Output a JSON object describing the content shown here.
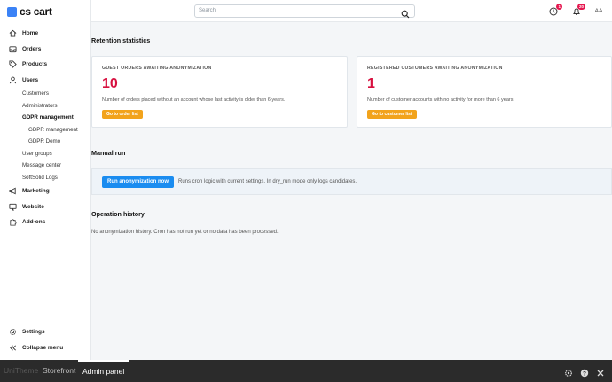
{
  "app": {
    "logo_text": "cs cart",
    "accent": "#3b82f6"
  },
  "sidebar": {
    "items": [
      {
        "label": "Home",
        "icon": "home-icon"
      },
      {
        "label": "Orders",
        "icon": "inbox-icon"
      },
      {
        "label": "Products",
        "icon": "tag-icon"
      },
      {
        "label": "Users",
        "icon": "users-icon"
      }
    ],
    "users_sub": [
      "Customers",
      "Administrators",
      "GDPR management"
    ],
    "gdpr_sub": [
      "GDPR management",
      "GDPR Demo"
    ],
    "users_sub2": [
      "User groups",
      "Message center",
      "SoftSolid Logs"
    ],
    "items2": [
      {
        "label": "Marketing",
        "icon": "megaphone-icon"
      },
      {
        "label": "Website",
        "icon": "monitor-icon"
      },
      {
        "label": "Add-ons",
        "icon": "puzzle-icon"
      }
    ],
    "settings_label": "Settings",
    "collapse_label": "Collapse menu"
  },
  "topbar": {
    "search_placeholder": "Search",
    "notif_badge": "1",
    "bell_badge": "20",
    "avatar": "AA"
  },
  "main": {
    "retention_title": "Retention statistics",
    "cards": [
      {
        "title": "GUEST ORDERS AWAITING ANONYMIZATION",
        "count": "10",
        "desc": "Number of orders placed without an account whose last activity is older than 6 years.",
        "button": "Go to order list"
      },
      {
        "title": "REGISTERED CUSTOMERS AWAITING ANONYMIZATION",
        "count": "1",
        "desc": "Number of customer accounts with no activity for more than 6 years.",
        "button": "Go to customer list"
      }
    ],
    "manual_title": "Manual run",
    "run_button": "Run anonymization now",
    "run_desc": "Runs cron logic with current settings. In dry_run mode only logs candidates.",
    "history_title": "Operation history",
    "history_empty": "No anonymization history. Cron has not run yet or no data has been processed."
  },
  "bottombar": {
    "tabs": [
      "UniTheme",
      "Storefront",
      "Admin panel"
    ]
  }
}
